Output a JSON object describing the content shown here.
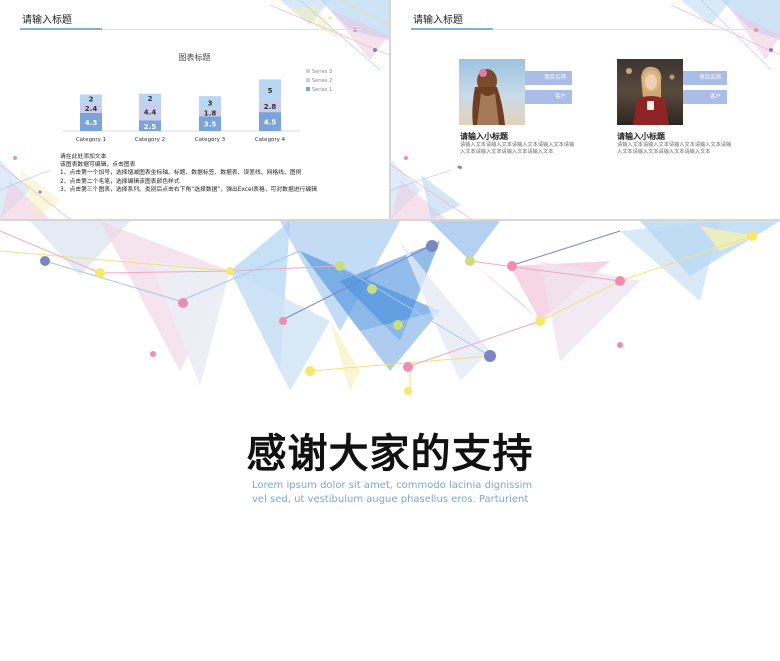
{
  "slide1": {
    "title": "请输入标题",
    "chart_data": {
      "type": "bar",
      "title": "图表标题",
      "stacked": true,
      "categories": [
        "Category 1",
        "Category 2",
        "Category 3",
        "Category 4"
      ],
      "series": [
        {
          "name": "Series 1",
          "values": [
            4.3,
            2.5,
            3.5,
            4.5
          ],
          "color": "#7ba4d9"
        },
        {
          "name": "Series 2",
          "values": [
            2.4,
            4.4,
            1.8,
            2.8
          ],
          "color": "#c9cdee"
        },
        {
          "name": "Series 3",
          "values": [
            2,
            2,
            3,
            5
          ],
          "color": "#b8d8f2"
        }
      ],
      "legend": "right",
      "grid": false
    },
    "notes": [
      "请在此处添加文本",
      "该图表数据可编辑，点击图表",
      "1、点击第一个加号，选择增减图表坐标轴、标题、数据标签、数据表、误差线、网格线、图例",
      "2、点击第二个毛笔，选择编辑该图表颜色样式",
      "3、点击第三个图表，选择系列、类别后点击右下角“选择数据”，弹出Excel表格，可对数据进行编辑"
    ]
  },
  "slide2": {
    "title": "请输入标题",
    "cards": [
      {
        "tag1": "项目名称",
        "tag2": "客户",
        "subtitle": "请输入小标题",
        "text": "请输入文本请输入文本请输入文本请输入文本请输入文本请输入文本请输入文本请输入文本"
      },
      {
        "tag1": "项目名称",
        "tag2": "客户",
        "subtitle": "请输入小标题",
        "text": "请输入文本请输入文本请输入文本请输入文本请输入文本请输入文本请输入文本请输入文本"
      }
    ]
  },
  "slide3": {
    "headline": "感谢大家的支持",
    "subtext": "Lorem ipsum dolor sit amet, commodo lacinia dignissim vel sed, ut vestibulum augue phasellus eros. Parturient"
  },
  "colors": {
    "accent_blue": "#7fb0dc",
    "pink": "#f08cb4",
    "yellow": "#f7e76a",
    "purple": "#7a86c8"
  }
}
